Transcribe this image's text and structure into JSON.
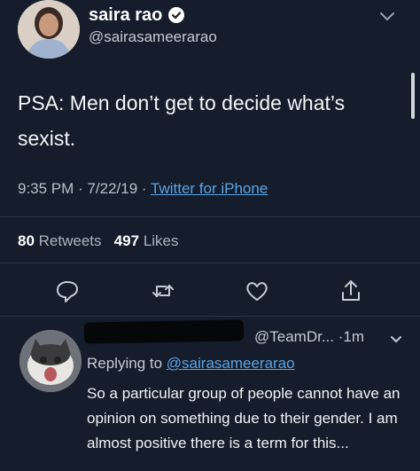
{
  "tweet": {
    "display_name": "saira rao",
    "handle": "@sairasameerarao",
    "text": "PSA: Men don’t get to decide what’s sexist.",
    "time": "9:35 PM",
    "date": "7/22/19",
    "source": "Twitter for iPhone",
    "separator": "·",
    "retweets_count": "80",
    "retweets_label": "Retweets",
    "likes_count": "497",
    "likes_label": "Likes"
  },
  "reply": {
    "handle": "@TeamDr...",
    "time_sep": "·",
    "time": "1m",
    "replying_prefix": "Replying to",
    "replying_handle": "@sairasameerarao",
    "text": "So a particular group of people cannot have an opinion on something due to their gender. I am almost positive there is a term for this..."
  },
  "icons": {
    "verified": "verified-badge-icon",
    "reply": "reply-icon",
    "retweet": "retweet-icon",
    "like": "heart-icon",
    "share": "share-icon",
    "menu": "chevron-down-icon"
  },
  "colors": {
    "background": "#151c2b",
    "link": "#5ba4e6",
    "verified": "#ffffff"
  }
}
